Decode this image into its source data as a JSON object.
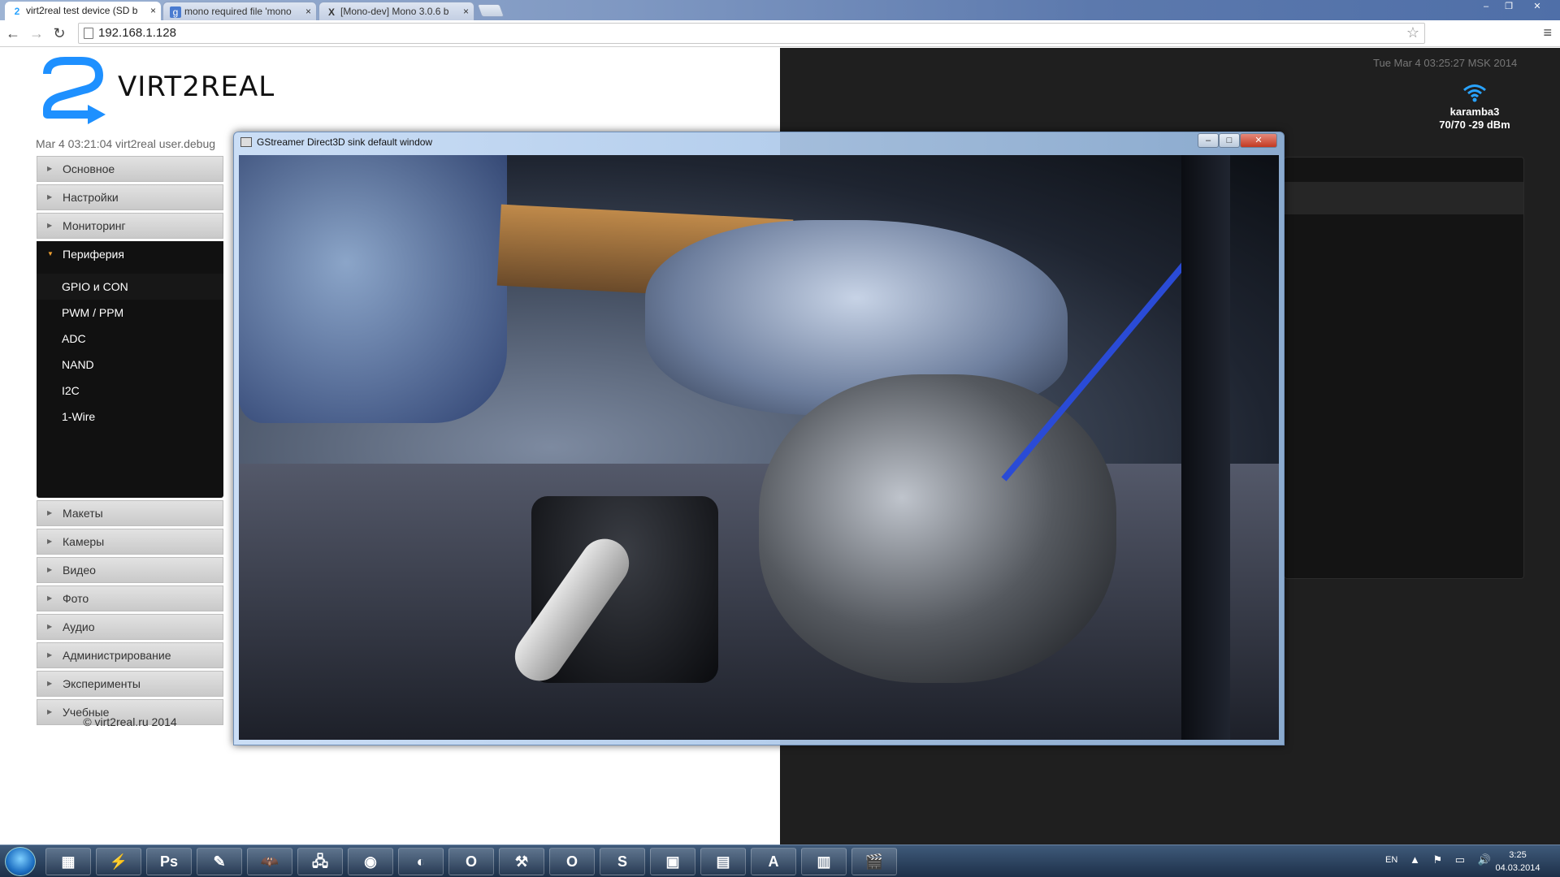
{
  "browser": {
    "tabs": [
      {
        "title": "virt2real test device (SD b",
        "active": true,
        "icon": "virt2real-favicon"
      },
      {
        "title": "mono required file 'mono",
        "active": false,
        "icon": "google-favicon"
      },
      {
        "title": "[Mono-dev] Mono 3.0.6 b",
        "active": false,
        "icon": "x-favicon"
      }
    ],
    "tab_close": "×",
    "url": "192.168.1.128"
  },
  "page": {
    "logo_text": "VIRT2REAL",
    "log_line": "Mar 4 03:21:04 virt2real user.debug",
    "menu": [
      {
        "label": "Основное"
      },
      {
        "label": "Настройки"
      },
      {
        "label": "Мониторинг"
      },
      {
        "label": "Периферия",
        "open": true
      }
    ],
    "submenu": [
      "GPIO и CON",
      "PWM / PPM",
      "ADC",
      "NAND",
      "I2C",
      "1-Wire"
    ],
    "menu_after": [
      {
        "label": "Макеты"
      },
      {
        "label": "Камеры"
      },
      {
        "label": "Видео"
      },
      {
        "label": "Фото"
      },
      {
        "label": "Аудио"
      },
      {
        "label": "Администрирование"
      },
      {
        "label": "Эксперименты"
      },
      {
        "label": "Учебные"
      }
    ],
    "copyright": "© virt2real.ru 2014",
    "clock": "Tue Mar 4 03:25:27 MSK 2014",
    "wifi": {
      "ssid": "karamba3",
      "signal": "70/70 -29 dBm",
      "icon": "wifi-icon"
    }
  },
  "gstreamer": {
    "title": "GStreamer Direct3D sink default window",
    "buttons": {
      "minimize": "–",
      "maximize": "□",
      "close": "✕"
    }
  },
  "taskbar": {
    "apps": [
      {
        "name": "explorer",
        "glyph": "▦"
      },
      {
        "name": "winamp",
        "glyph": "⚡"
      },
      {
        "name": "photoshop",
        "glyph": "Ps"
      },
      {
        "name": "notepad",
        "glyph": "✎"
      },
      {
        "name": "batman",
        "glyph": "🦇"
      },
      {
        "name": "network",
        "glyph": "🖧"
      },
      {
        "name": "chrome",
        "glyph": "◉"
      },
      {
        "name": "firefox",
        "glyph": "◐"
      },
      {
        "name": "opera",
        "glyph": "O"
      },
      {
        "name": "tools",
        "glyph": "⚒"
      },
      {
        "name": "opera-next",
        "glyph": "O"
      },
      {
        "name": "skype",
        "glyph": "S"
      },
      {
        "name": "virtualbox",
        "glyph": "▣"
      },
      {
        "name": "notes",
        "glyph": "▤"
      },
      {
        "name": "acrobat",
        "glyph": "A"
      },
      {
        "name": "terminal",
        "glyph": "▥"
      },
      {
        "name": "video-player",
        "glyph": "🎬"
      }
    ],
    "lang": "EN",
    "time": "3:25",
    "date": "04.03.2014"
  },
  "colors": {
    "accent_blue": "#29a3ff",
    "menu_open_bg": "#111111"
  }
}
